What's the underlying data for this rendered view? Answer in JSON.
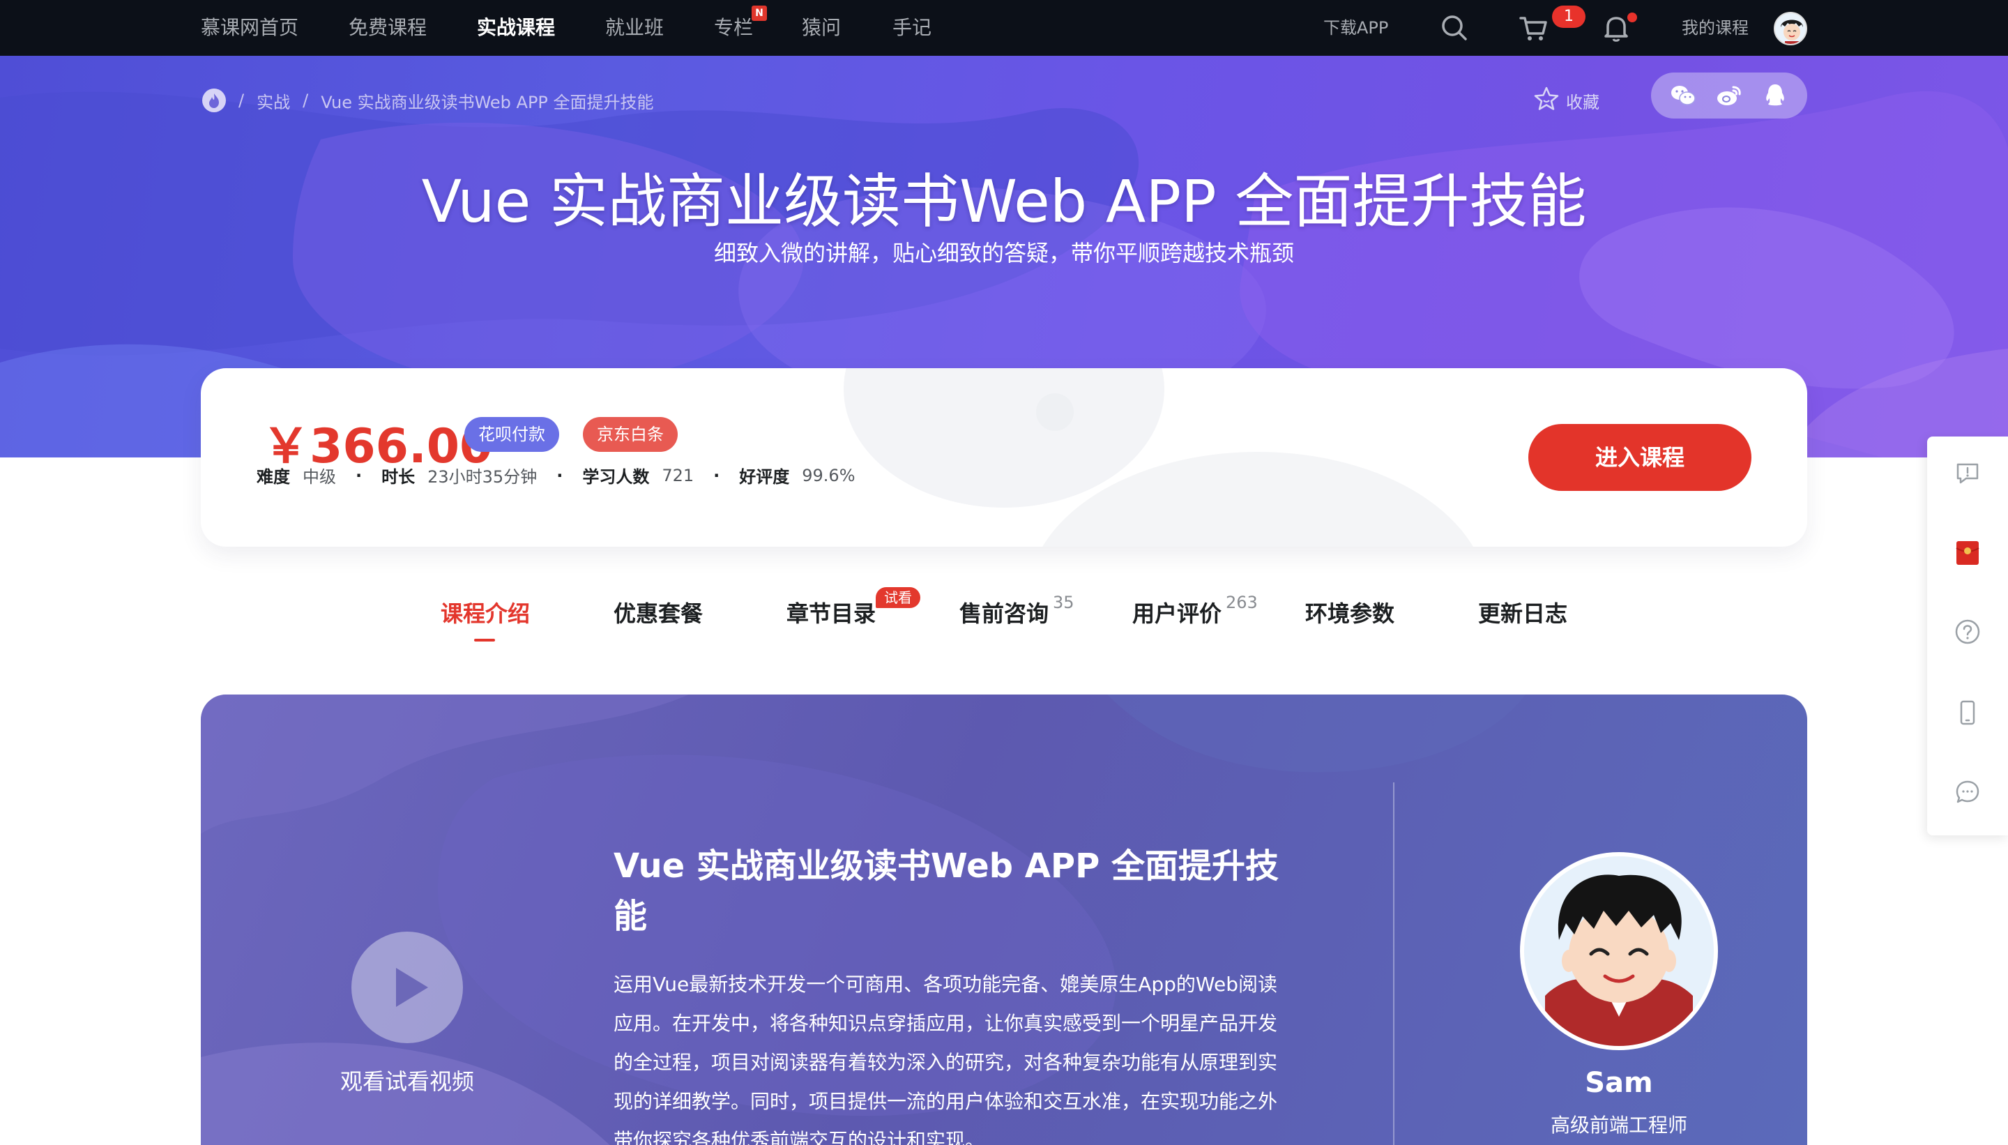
{
  "nav": {
    "items": [
      {
        "label": "慕课网首页",
        "active": false
      },
      {
        "label": "免费课程",
        "active": false
      },
      {
        "label": "实战课程",
        "active": true
      },
      {
        "label": "就业班",
        "active": false
      },
      {
        "label": "专栏",
        "active": false,
        "badge": "N"
      },
      {
        "label": "猿问",
        "active": false
      },
      {
        "label": "手记",
        "active": false
      }
    ],
    "download_app": "下载APP",
    "cart_count": "1",
    "my_courses": "我的课程"
  },
  "breadcrumb": {
    "items": [
      "实战",
      "Vue 实战商业级读书Web APP 全面提升技能"
    ],
    "separator": "/"
  },
  "collect_label": "收藏",
  "hero": {
    "title": "Vue 实战商业级读书Web APP 全面提升技能",
    "subtitle": "细致入微的讲解，贴心细致的答疑，带你平顺跨越技术瓶颈"
  },
  "price_card": {
    "price": "￥366.00",
    "payment_tags": [
      "花呗付款",
      "京东白条"
    ],
    "meta": [
      {
        "key": "难度",
        "value": "中级"
      },
      {
        "key": "时长",
        "value": "23小时35分钟"
      },
      {
        "key": "学习人数",
        "value": "721"
      },
      {
        "key": "好评度",
        "value": "99.6%"
      }
    ],
    "enter_button": "进入课程"
  },
  "tabs": [
    {
      "label": "课程介绍",
      "active": true
    },
    {
      "label": "优惠套餐"
    },
    {
      "label": "章节目录",
      "badge": "试看"
    },
    {
      "label": "售前咨询",
      "count": "35"
    },
    {
      "label": "用户评价",
      "count": "263"
    },
    {
      "label": "环境参数"
    },
    {
      "label": "更新日志"
    }
  ],
  "intro": {
    "play_label": "观看试看视频",
    "title": "Vue 实战商业级读书Web APP 全面提升技能",
    "description": "运用Vue最新技术开发一个可商用、各项功能完备、媲美原生App的Web阅读应用。在开发中，将各种知识点穿插应用，让你真实感受到一个明星产品开发的全过程，项目对阅读器有着较为深入的研究，对各种复杂功能有从原理到实现的详细教学。同时，项目提供一流的用户体验和交互水准，在实现功能之外带你探究各种优秀前端交互的设计和实现。",
    "teacher": {
      "name": "Sam",
      "title": "高级前端工程师"
    }
  },
  "float_bar": {
    "icons": [
      "feedback-icon",
      "red-packet-icon",
      "help-icon",
      "mobile-icon",
      "chat-icon"
    ]
  },
  "colors": {
    "accent_red": "#e3342a",
    "nav_bg": "#0c1018",
    "hero_purple": "#5a5be0",
    "huabei_blue": "#6a70e6",
    "jd_red": "#e85a52"
  }
}
